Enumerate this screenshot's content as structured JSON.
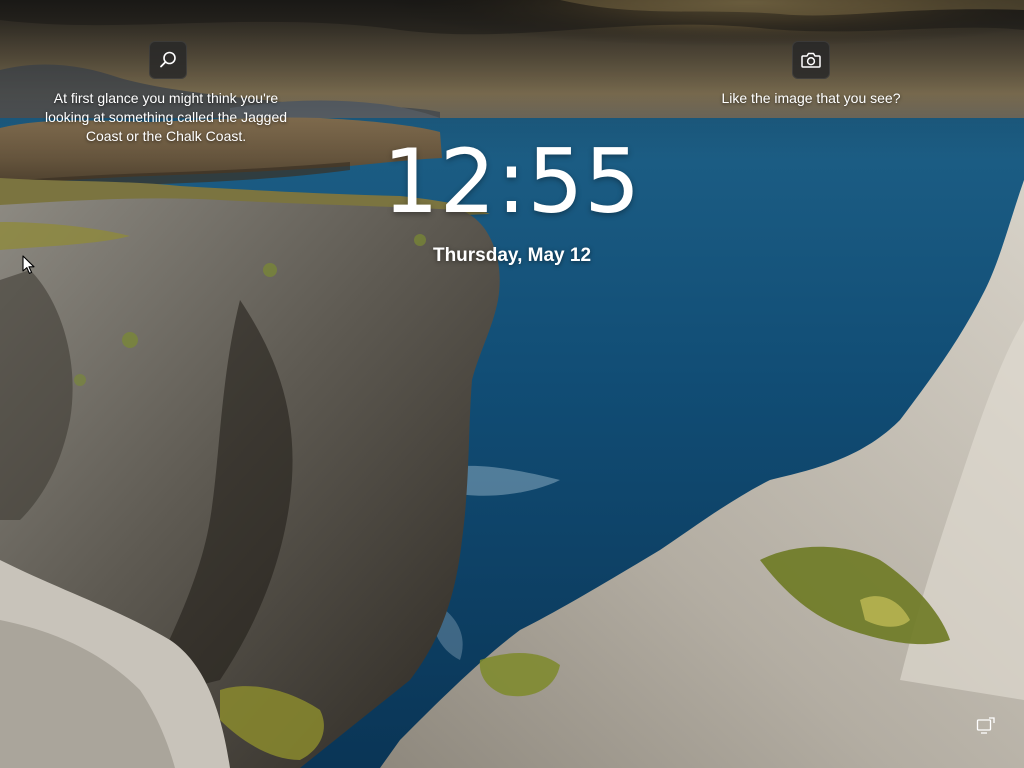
{
  "lockscreen": {
    "time": "12:55",
    "date": "Thursday, May 12"
  },
  "spotlight": {
    "search_icon": "search-icon",
    "camera_icon": "camera-icon",
    "caption_left": "At first glance you might think you're looking at something called the Jagged Coast or the Chalk Coast.",
    "caption_right": "Like the image that you see?"
  },
  "corner_icon": "accessibility-icon",
  "colors": {
    "sky_dark": "#3b3a36",
    "sky_glow": "#d9b86a",
    "sea": "#0f4f78",
    "cliff": "#a7a095",
    "vegetation": "#7e8a2a",
    "text": "#ffffff",
    "button_bg": "#282828"
  }
}
